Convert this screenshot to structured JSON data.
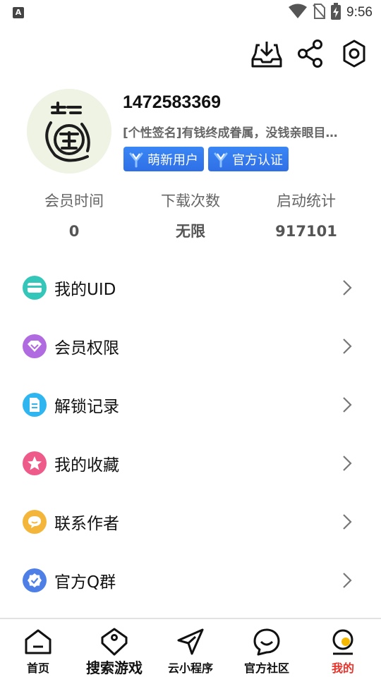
{
  "status_bar": {
    "time": "9:56",
    "left_badge": "A",
    "icons": [
      "wifi-icon",
      "no-sim-icon",
      "battery-charging-icon"
    ]
  },
  "top_actions": [
    "download-inbox-icon",
    "share-icon",
    "settings-icon"
  ],
  "profile": {
    "title": "1472583369",
    "signature": "[个性签名]有钱终成眷属，没钱亲眼目…",
    "badges": [
      {
        "label": "萌新用户",
        "icon": "tuning-fork-icon"
      },
      {
        "label": "官方认证",
        "icon": "tuning-fork-icon"
      }
    ]
  },
  "stats": [
    {
      "label": "会员时间",
      "value": "0"
    },
    {
      "label": "下载次数",
      "value": "无限"
    },
    {
      "label": "启动统计",
      "value": "917101"
    }
  ],
  "menu": [
    {
      "label": "我的UID",
      "icon": "card-icon",
      "color": "#34c6b8"
    },
    {
      "label": "会员权限",
      "icon": "vip-diamond-icon",
      "color": "#b06be0"
    },
    {
      "label": "解锁记录",
      "icon": "document-icon",
      "color": "#2fb5f0"
    },
    {
      "label": "我的收藏",
      "icon": "star-icon",
      "color": "#ee5a8a"
    },
    {
      "label": "联系作者",
      "icon": "chat-icon",
      "color": "#f4b63a"
    },
    {
      "label": "官方Q群",
      "icon": "verified-icon",
      "color": "#4d7fe6"
    }
  ],
  "bottom_nav": [
    {
      "label": "首页",
      "icon": "home-icon",
      "active": false
    },
    {
      "label": "搜索游戏",
      "icon": "tag-icon",
      "active": false
    },
    {
      "label": "云小程序",
      "icon": "send-icon",
      "active": false
    },
    {
      "label": "官方社区",
      "icon": "smile-chat-icon",
      "active": false
    },
    {
      "label": "我的",
      "icon": "profile-icon",
      "active": true
    }
  ],
  "colors": {
    "accent_red": "#e8332a",
    "badge_blue": "#3a7cf2",
    "active_dot": "#f5b800"
  }
}
